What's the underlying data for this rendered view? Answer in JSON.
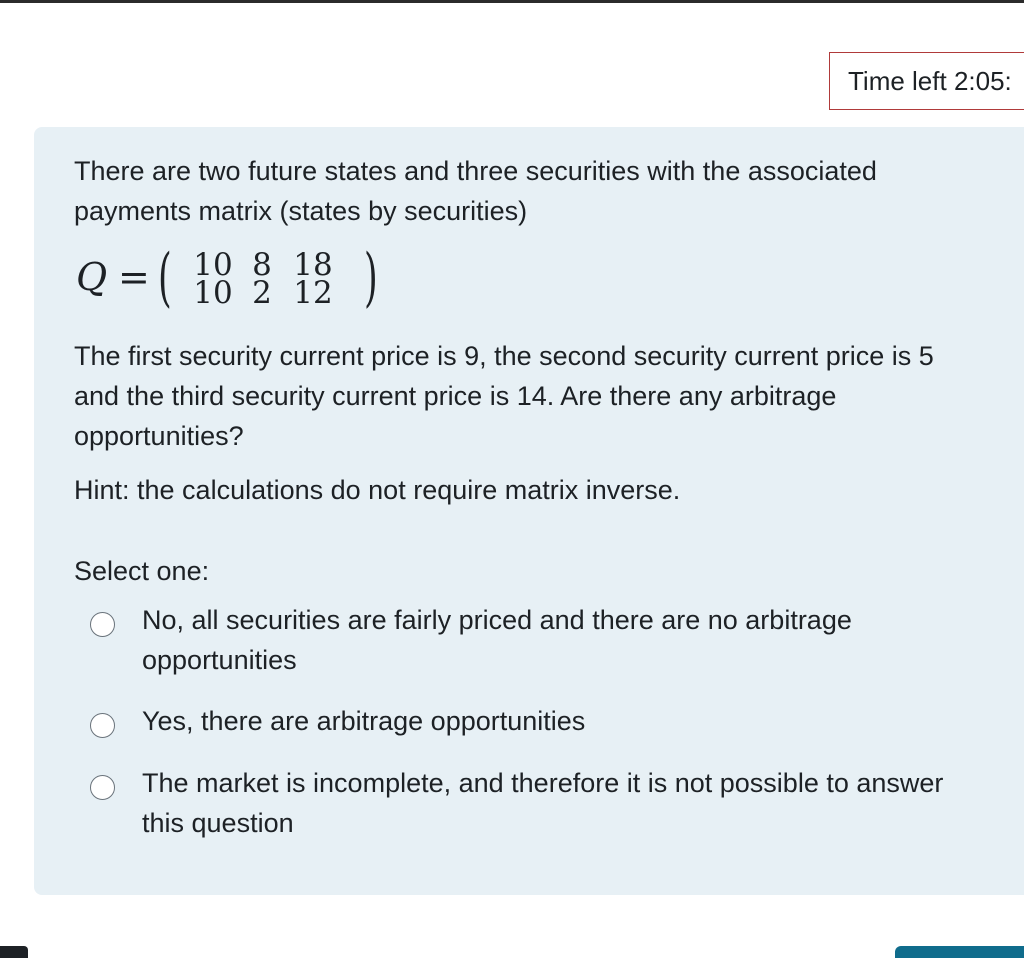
{
  "timer": {
    "text": "Time left 2:05:"
  },
  "question": {
    "intro_line1": "There are two future states and three securities with the associated",
    "intro_line2": "payments matrix (states by securities)",
    "formula": {
      "variable": "Q",
      "equals": "=",
      "matrix": [
        [
          "10",
          "8",
          "18"
        ],
        [
          "10",
          "2",
          "12"
        ]
      ]
    },
    "body_line1": "The first security current price is 9, the second security current price is 5",
    "body_line2": "and the third security current price is 14. Are there any arbitrage",
    "body_line3": "opportunities?",
    "hint": "Hint: the calculations do not require matrix inverse.",
    "select_prompt": "Select one:"
  },
  "options": [
    {
      "line1": "No, all securities are fairly priced and there are no arbitrage",
      "line2": "opportunities",
      "selected": false
    },
    {
      "line1": "Yes, there are arbitrage opportunities",
      "line2": "",
      "selected": false
    },
    {
      "line1": "The market is incomplete, and therefore it is not possible to answer",
      "line2": "this question",
      "selected": false
    }
  ],
  "colors": {
    "panel_background": "#e7f0f5",
    "timer_border": "#b03a3a",
    "text": "#1d2125",
    "primary_button": "#0f6c8c"
  }
}
